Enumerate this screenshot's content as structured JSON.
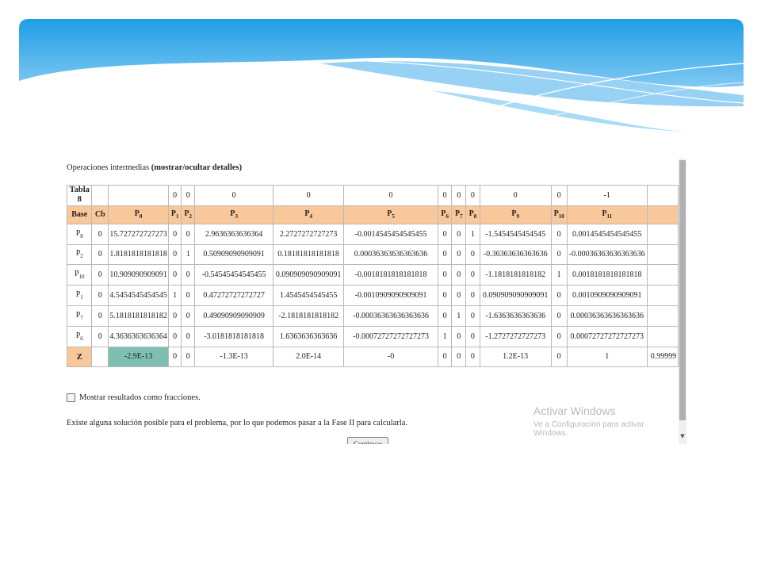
{
  "ops_line": {
    "prefix": "Operaciones intermedias",
    "toggle": "(mostrar/ocultar detalles)"
  },
  "table": {
    "tabla_label": "Tabla",
    "tabla_num": "8",
    "cost_row": [
      "",
      "0",
      "0",
      "0",
      "0",
      "0",
      "0",
      "0",
      "0",
      "0",
      "0",
      "-1",
      ""
    ],
    "headers": [
      "Base",
      "Cb",
      "P0",
      "P1",
      "P2",
      "P3",
      "P4",
      "P5",
      "P6",
      "P7",
      "P8",
      "P9",
      "P10",
      "P11",
      ""
    ],
    "rows": [
      [
        "P8",
        "0",
        "15.727272727273",
        "0",
        "0",
        "2.9636363636364",
        "2.2727272727273",
        "-0.0014545454545455",
        "0",
        "0",
        "1",
        "-1.5454545454545",
        "0",
        "0.0014545454545455",
        ""
      ],
      [
        "P2",
        "0",
        "1.8181818181818",
        "0",
        "1",
        "0.50909090909091",
        "0.18181818181818",
        "0.00036363636363636",
        "0",
        "0",
        "0",
        "-0.36363636363636",
        "0",
        "-0.00036363636363636",
        ""
      ],
      [
        "P10",
        "0",
        "10.909090909091",
        "0",
        "0",
        "-0.54545454545455",
        "0.090909090909091",
        "-0.0018181818181818",
        "0",
        "0",
        "0",
        "-1.1818181818182",
        "1",
        "0.0018181818181818",
        ""
      ],
      [
        "P1",
        "0",
        "4.5454545454545",
        "1",
        "0",
        "0.47272727272727",
        "1.4545454545455",
        "-0.0010909090909091",
        "0",
        "0",
        "0",
        "0.090909090909091",
        "0",
        "0.0010909090909091",
        ""
      ],
      [
        "P7",
        "0",
        "5.1818181818182",
        "0",
        "0",
        "0.49090909090909",
        "-2.1818181818182",
        "-0.00036363636363636",
        "0",
        "1",
        "0",
        "-1.6363636363636",
        "0",
        "0.00036363636363636",
        ""
      ],
      [
        "P6",
        "0",
        "4.3636363636364",
        "0",
        "0",
        "-3.0181818181818",
        "1.6363636363636",
        "-0.00072727272727273",
        "1",
        "0",
        "0",
        "-1.2727272727273",
        "0",
        "0.00072727272727273",
        ""
      ]
    ],
    "z_row": [
      "Z",
      "",
      "-2.9E-13",
      "0",
      "0",
      "-1.3E-13",
      "2.0E-14",
      "-0",
      "0",
      "0",
      "0",
      "1.2E-13",
      "0",
      "1",
      "0.99999"
    ]
  },
  "fractions_label": "Mostrar resultados como fracciones.",
  "message": "Existe alguna solución posible para el problema, por lo que podemos pasar a la Fase II para calcularla.",
  "continue_label": "Continuar",
  "watermark": {
    "title": "Activar Windows",
    "subtitle": "Ve a Configuración para activar Windows."
  },
  "colors": {
    "header_bg": "#f9c89a",
    "z_value_bg": "#7fbfb2",
    "banner_top": "#1e9ee6",
    "banner_bottom": "#9fd6f7"
  }
}
